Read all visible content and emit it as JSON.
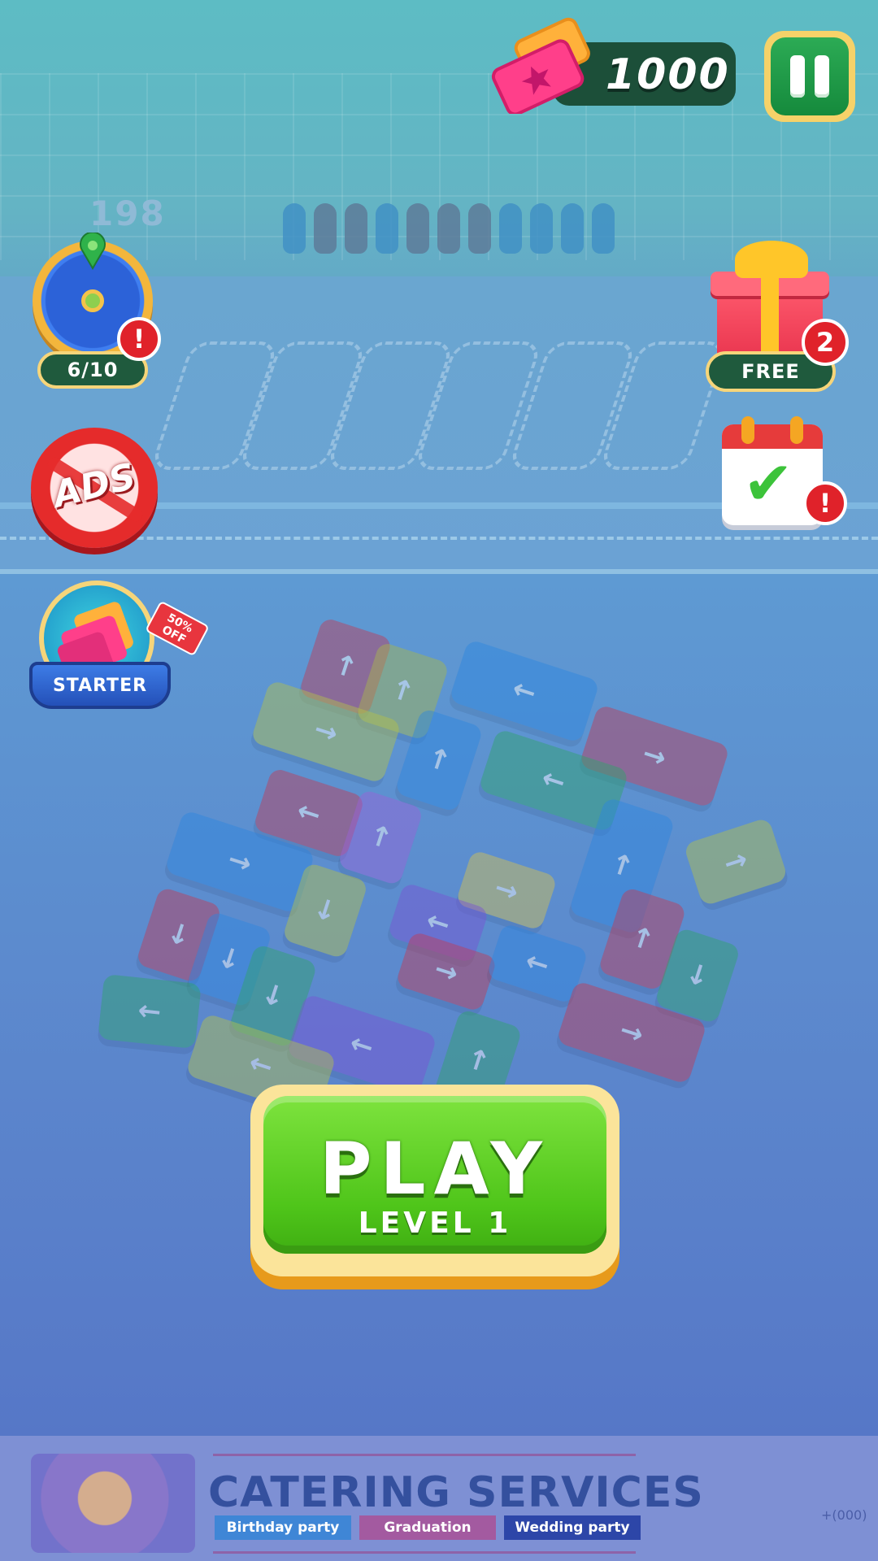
{
  "currency": {
    "tickets": "1000",
    "icon": "ticket-icon"
  },
  "scene": {
    "queue_count": "198"
  },
  "left_menu": {
    "wheel": {
      "progress": "6/10",
      "alert": "!",
      "icon": "prize-wheel-icon"
    },
    "no_ads": {
      "label": "ADS",
      "icon": "no-ads-icon"
    },
    "starter_pack": {
      "label": "STARTER",
      "discount": "50% OFF",
      "icon": "ticket-bundle-icon"
    }
  },
  "right_menu": {
    "free_gift": {
      "label": "FREE",
      "count": "2",
      "icon": "gift-box-icon"
    },
    "daily_calendar": {
      "alert": "!",
      "icon": "calendar-check-icon"
    }
  },
  "play": {
    "label": "PLAY",
    "level": "LEVEL 1"
  },
  "ad_banner": {
    "title": "CATERING SERVICES",
    "tags": [
      "Birthday party",
      "Graduation",
      "Wedding party"
    ],
    "phone": "+(000)"
  },
  "colors": {
    "play_green": "#5ccc24",
    "gold_border": "#f6d57a",
    "alert_red": "#e0222a",
    "dark_pill": "#1f5a3d"
  }
}
